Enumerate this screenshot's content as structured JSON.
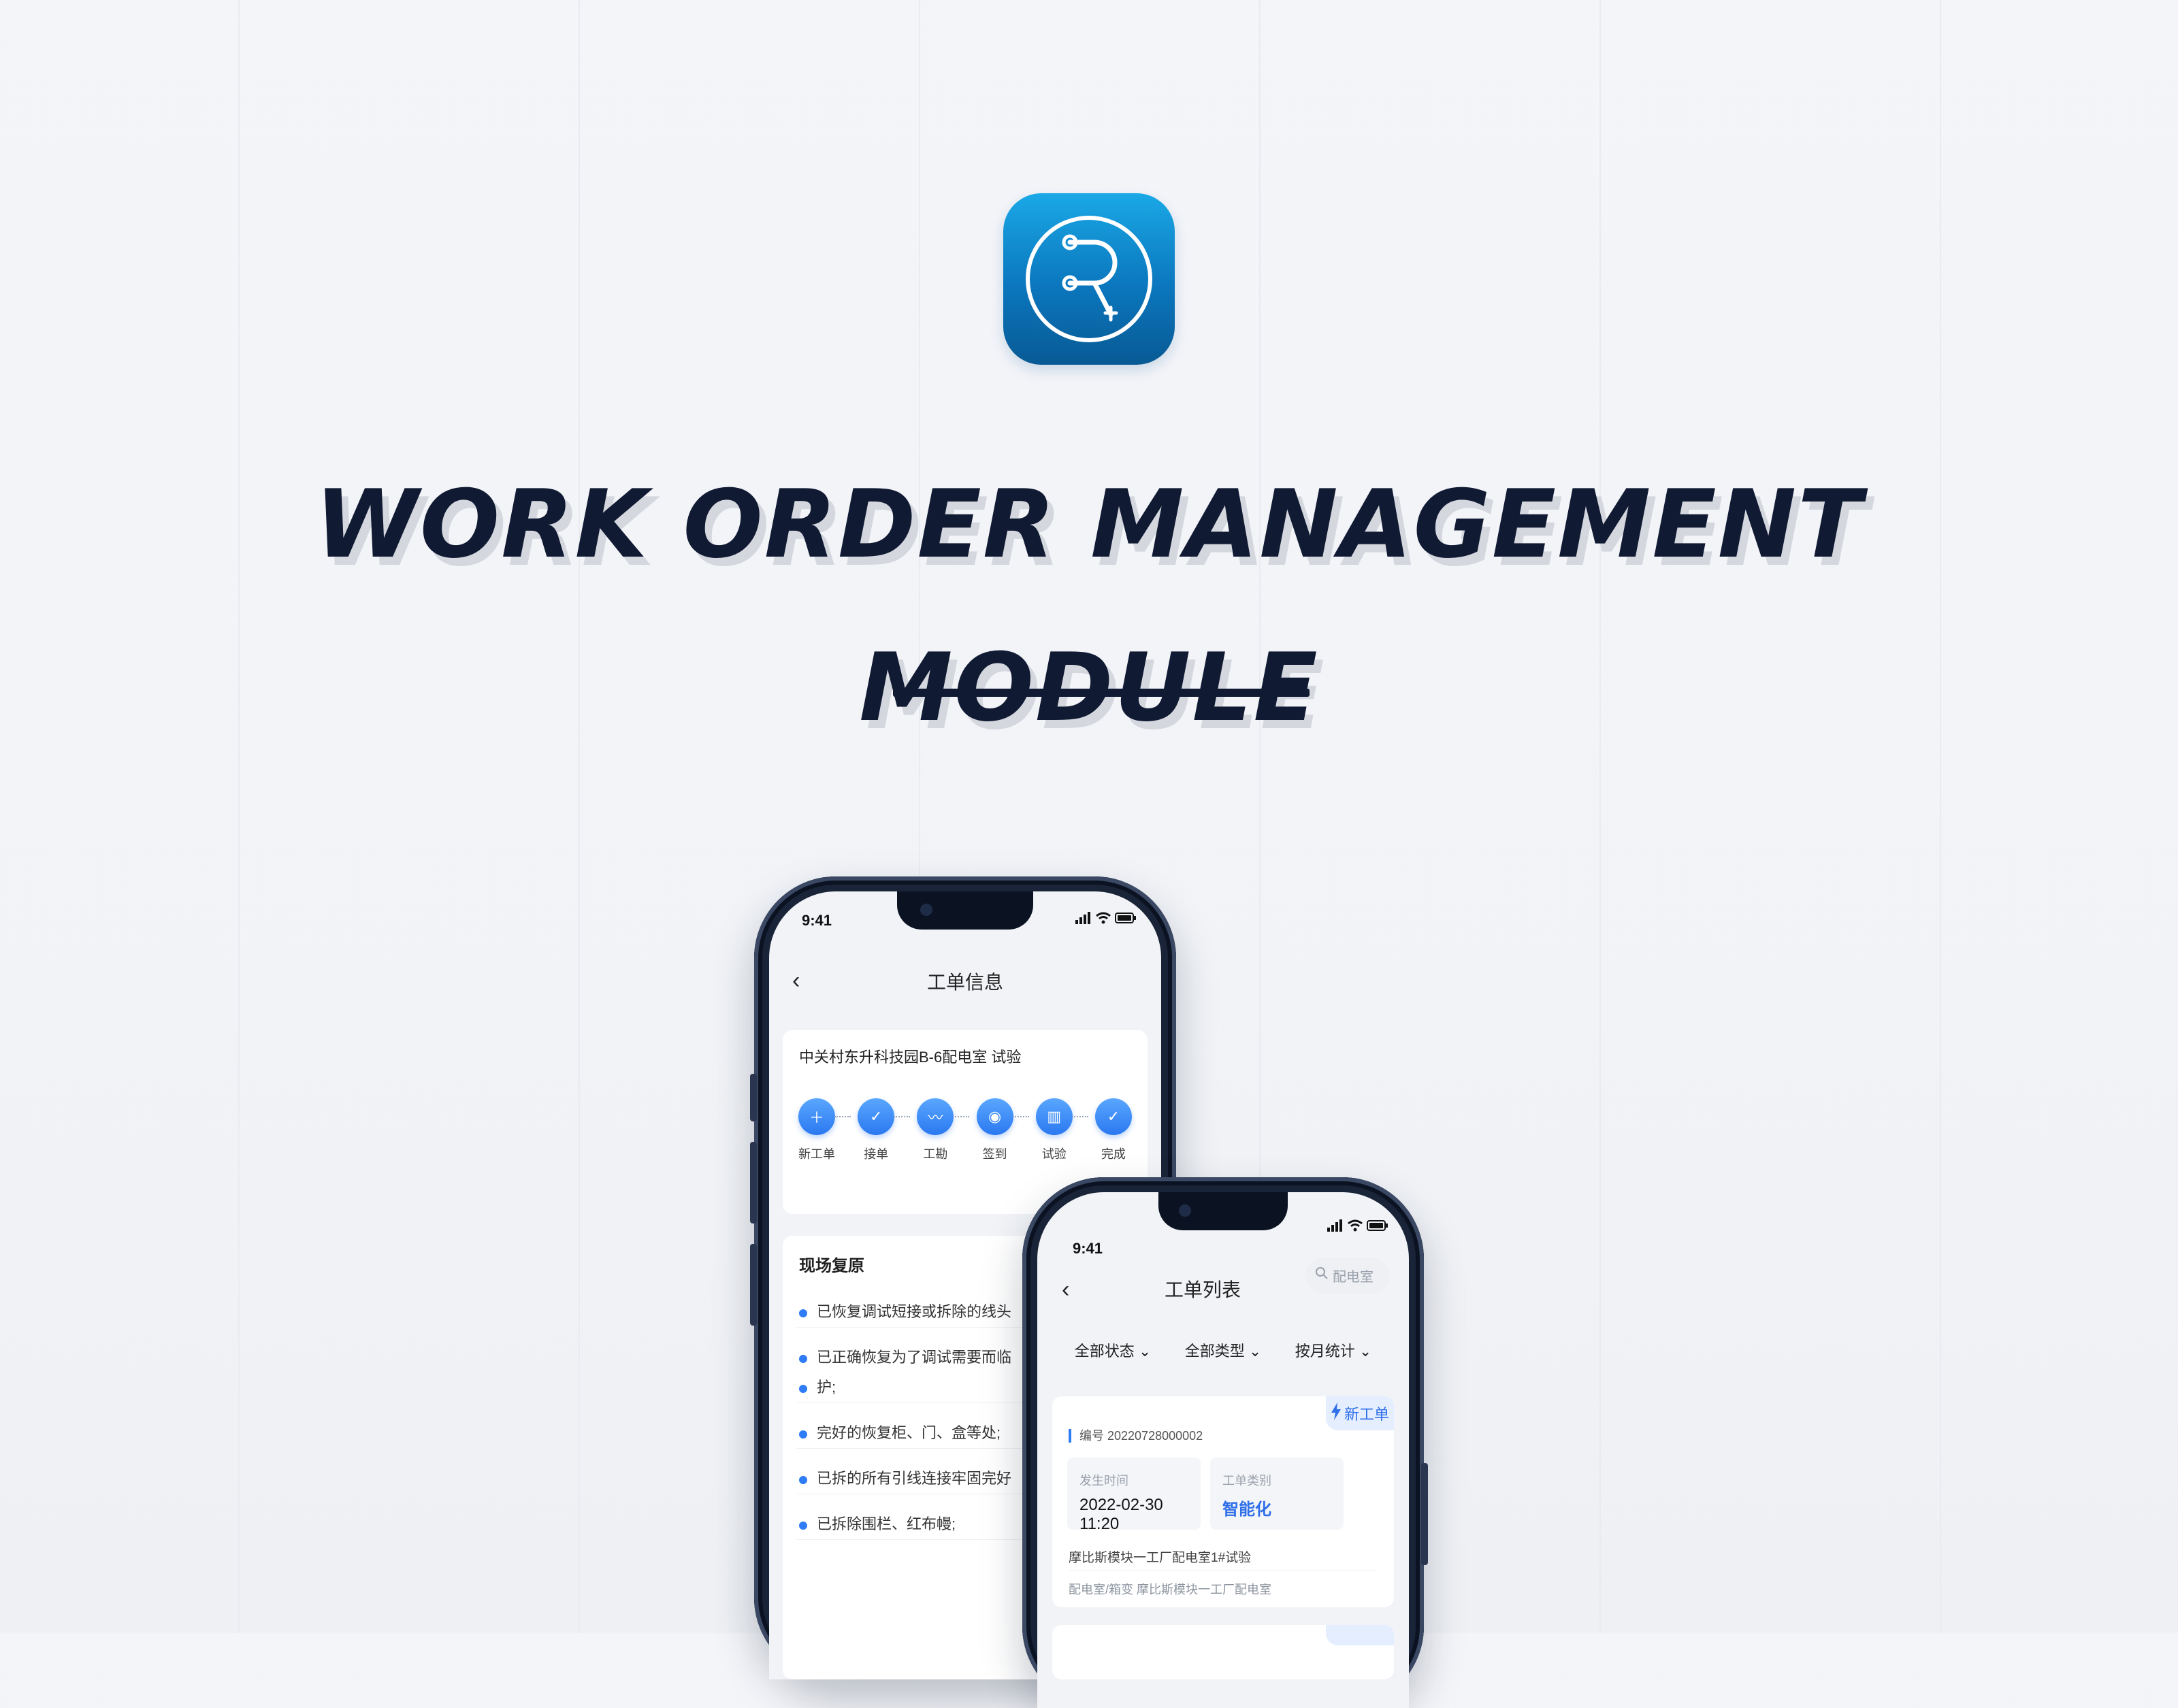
{
  "headline": {
    "line1": "WORK ORDER MANAGEMENT",
    "line2": "MODULE"
  },
  "app_icon": {
    "name": "app-logo-icon",
    "gradient": [
      "#1aa8e6",
      "#085a94"
    ]
  },
  "colors": {
    "accent": "#2f7cf6",
    "headline": "#111a33"
  },
  "phone_a": {
    "time": "9:41",
    "nav_title": "工单信息",
    "site_title": "中关村东升科技园B-6配电室  试验",
    "steps": [
      {
        "label": "新工单",
        "icon": "new-doc-icon"
      },
      {
        "label": "接单",
        "icon": "accept-icon"
      },
      {
        "label": "工勘",
        "icon": "survey-icon"
      },
      {
        "label": "签到",
        "icon": "location-pin-icon"
      },
      {
        "label": "试验",
        "icon": "chart-icon"
      },
      {
        "label": "完成",
        "icon": "check-icon"
      }
    ],
    "section_title": "现场复原",
    "checklist": [
      "已恢复调试短接或拆除的线头",
      "已正确恢复为了调试需要而临",
      "护;",
      "完好的恢复柜、门、盒等处;",
      "已拆的所有引线连接牢固完好",
      "已拆除围栏、红布幔;"
    ]
  },
  "phone_b": {
    "time": "9:41",
    "nav_title": "工单列表",
    "search_placeholder": "配电室",
    "filters": [
      "全部状态",
      "全部类型",
      "按月统计"
    ],
    "order": {
      "badge": "新工单",
      "number": "编号 20220728000002",
      "time_label": "发生时间",
      "time_value": "2022-02-30 11:20",
      "type_label": "工单类别",
      "type_value": "智能化",
      "title": "摩比斯模块一工厂配电室1#试验",
      "path": "配电室/箱变  摩比斯模块一工厂配电室"
    }
  }
}
